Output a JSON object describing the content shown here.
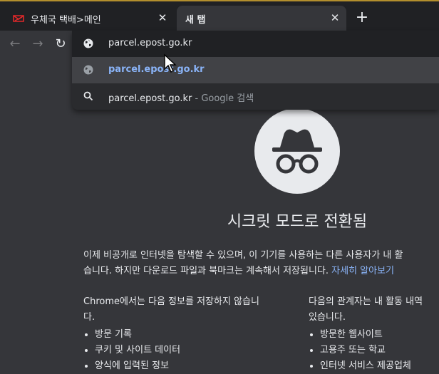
{
  "tabs": [
    {
      "title": "우체국 택배>메인",
      "close": "✕"
    },
    {
      "title": "새 탭",
      "close": "✕"
    }
  ],
  "new_tab_symbol": "+",
  "nav": {
    "back": "←",
    "forward": "→",
    "reload": "↻"
  },
  "omnibox": {
    "value": "parcel.epost.go.kr"
  },
  "suggestions": [
    {
      "icon": "globe-icon",
      "text": "parcel.epost.go.kr"
    },
    {
      "icon": "search-icon",
      "text": "parcel.epost.go.kr",
      "separator": " - ",
      "suffix": "Google 검색"
    }
  ],
  "incognito": {
    "heading": "시크릿 모드로 전환됨",
    "para_line1": "이제 비공개로 인터넷을 탐색할 수 있으며, 이 기기를 사용하는 다른 사용자가 내 활",
    "para_line2": "습니다. 하지만 다운로드 파일과 북마크는 계속해서 저장됩니다.",
    "learn_more": "자세히 알아보기",
    "left_col": {
      "title_line1": "Chrome에서는 다음 정보를 저장하지 않습니",
      "title_line2": "다.",
      "items": [
        "방문 기록",
        "쿠키 및 사이트 데이터",
        "양식에 입력된 정보"
      ]
    },
    "right_col": {
      "title_line1": "다음의 관계자는 내 활동 내역",
      "title_line2": "있습니다.",
      "items": [
        "방문한 웹사이트",
        "고용주 또는 학교",
        "인터넷 서비스 제공업체"
      ]
    }
  },
  "colors": {
    "background": "#35363a",
    "tabstrip": "#202124",
    "link": "#8ab4f8",
    "accent": "#b38f2d"
  }
}
